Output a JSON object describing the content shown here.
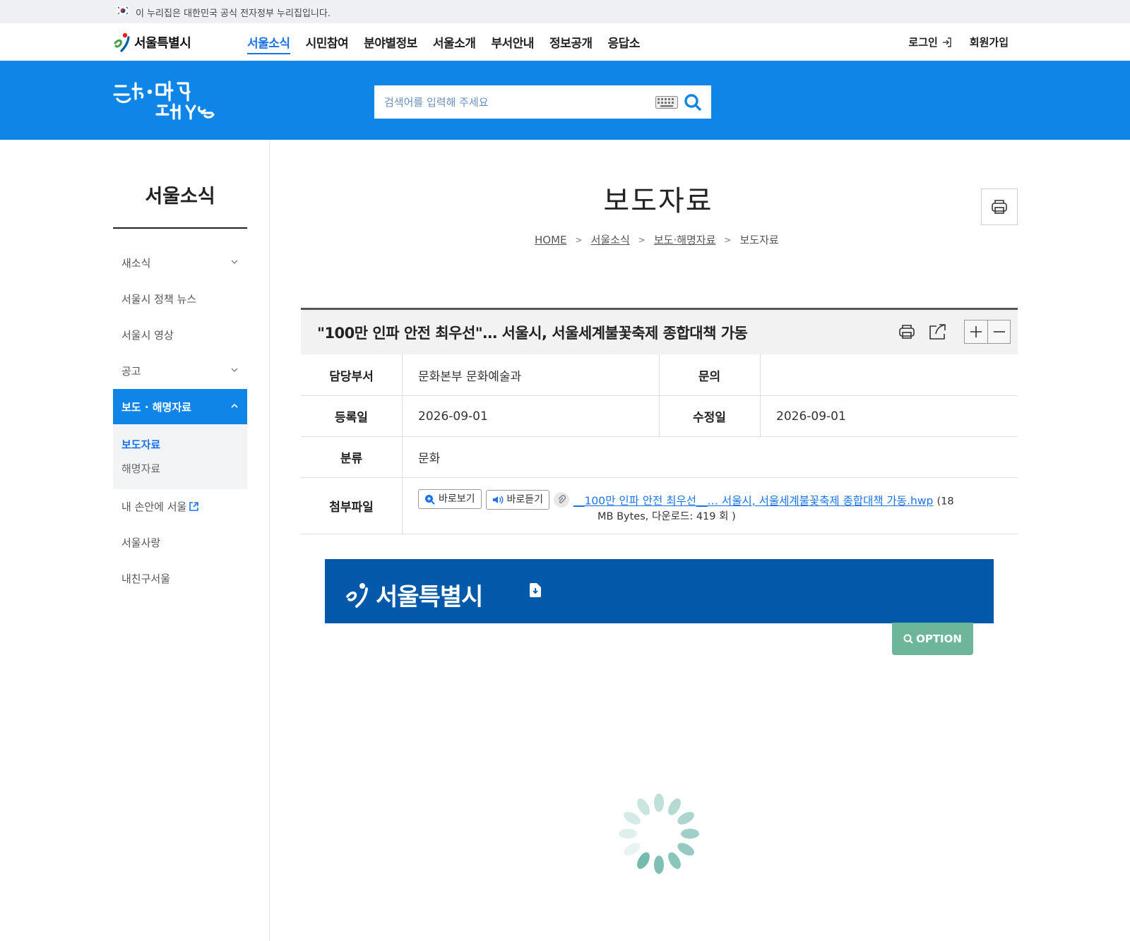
{
  "gov_banner": {
    "text": "이 누리집은 대한민국 공식 전자정부 누리집입니다."
  },
  "header": {
    "logo_text": "서울특별시",
    "menu": [
      "서울소식",
      "시민참여",
      "분야별정보",
      "서울소개",
      "부서안내",
      "정보공개",
      "응답소"
    ],
    "active_menu": "서울소식",
    "login": "로그인",
    "signup": "회원가입"
  },
  "search": {
    "placeholder": "검색어를 입력해 주세요"
  },
  "sidebar": {
    "title": "서울소식",
    "items": [
      {
        "label": "새소식",
        "has_children": true
      },
      {
        "label": "서울시 정책 뉴스"
      },
      {
        "label": "서울시 영상"
      },
      {
        "label": "공고",
        "has_children": true
      },
      {
        "label": "보도 · 해명자료",
        "open": true
      },
      {
        "label": "내 손안에 서울",
        "external": true
      },
      {
        "label": "서울사랑"
      },
      {
        "label": "내친구서울"
      }
    ],
    "sub_items": [
      {
        "label": "보도자료",
        "active": true
      },
      {
        "label": "해명자료"
      }
    ]
  },
  "page": {
    "title": "보도자료",
    "breadcrumb": [
      "HOME",
      "서울소식",
      "보도·해명자료",
      "보도자료"
    ]
  },
  "article": {
    "title": "\"100만 인파 안전 최우선\"… 서울시, 서울세계불꽃축제 종합대책 가동",
    "labels": {
      "dept": "담당부서",
      "contact": "문의",
      "registered": "등록일",
      "modified": "수정일",
      "category": "분류",
      "attachment": "첨부파일"
    },
    "dept": "문화본부 문화예술과",
    "contact": "",
    "registered": "2026-09-01",
    "modified": "2026-09-01",
    "category": "문화",
    "attachment": {
      "view_label": "바로보기",
      "listen_label": "바로듣기",
      "filename": "__100만 인파 안전 최우선__… 서울시, 서울세계불꽃축제 종합대책 가동.hwp",
      "size_prefix": "(18",
      "size_rest": "MB Bytes, 다운로드: 419 회 )"
    }
  },
  "viewer": {
    "logo_text": "서울특별시",
    "option_label": "OPTION"
  },
  "colors": {
    "brand_blue": "#1085e8",
    "viewer_blue": "#0258a9",
    "option_green": "#6eb69a",
    "link_blue": "#1a73e8"
  }
}
